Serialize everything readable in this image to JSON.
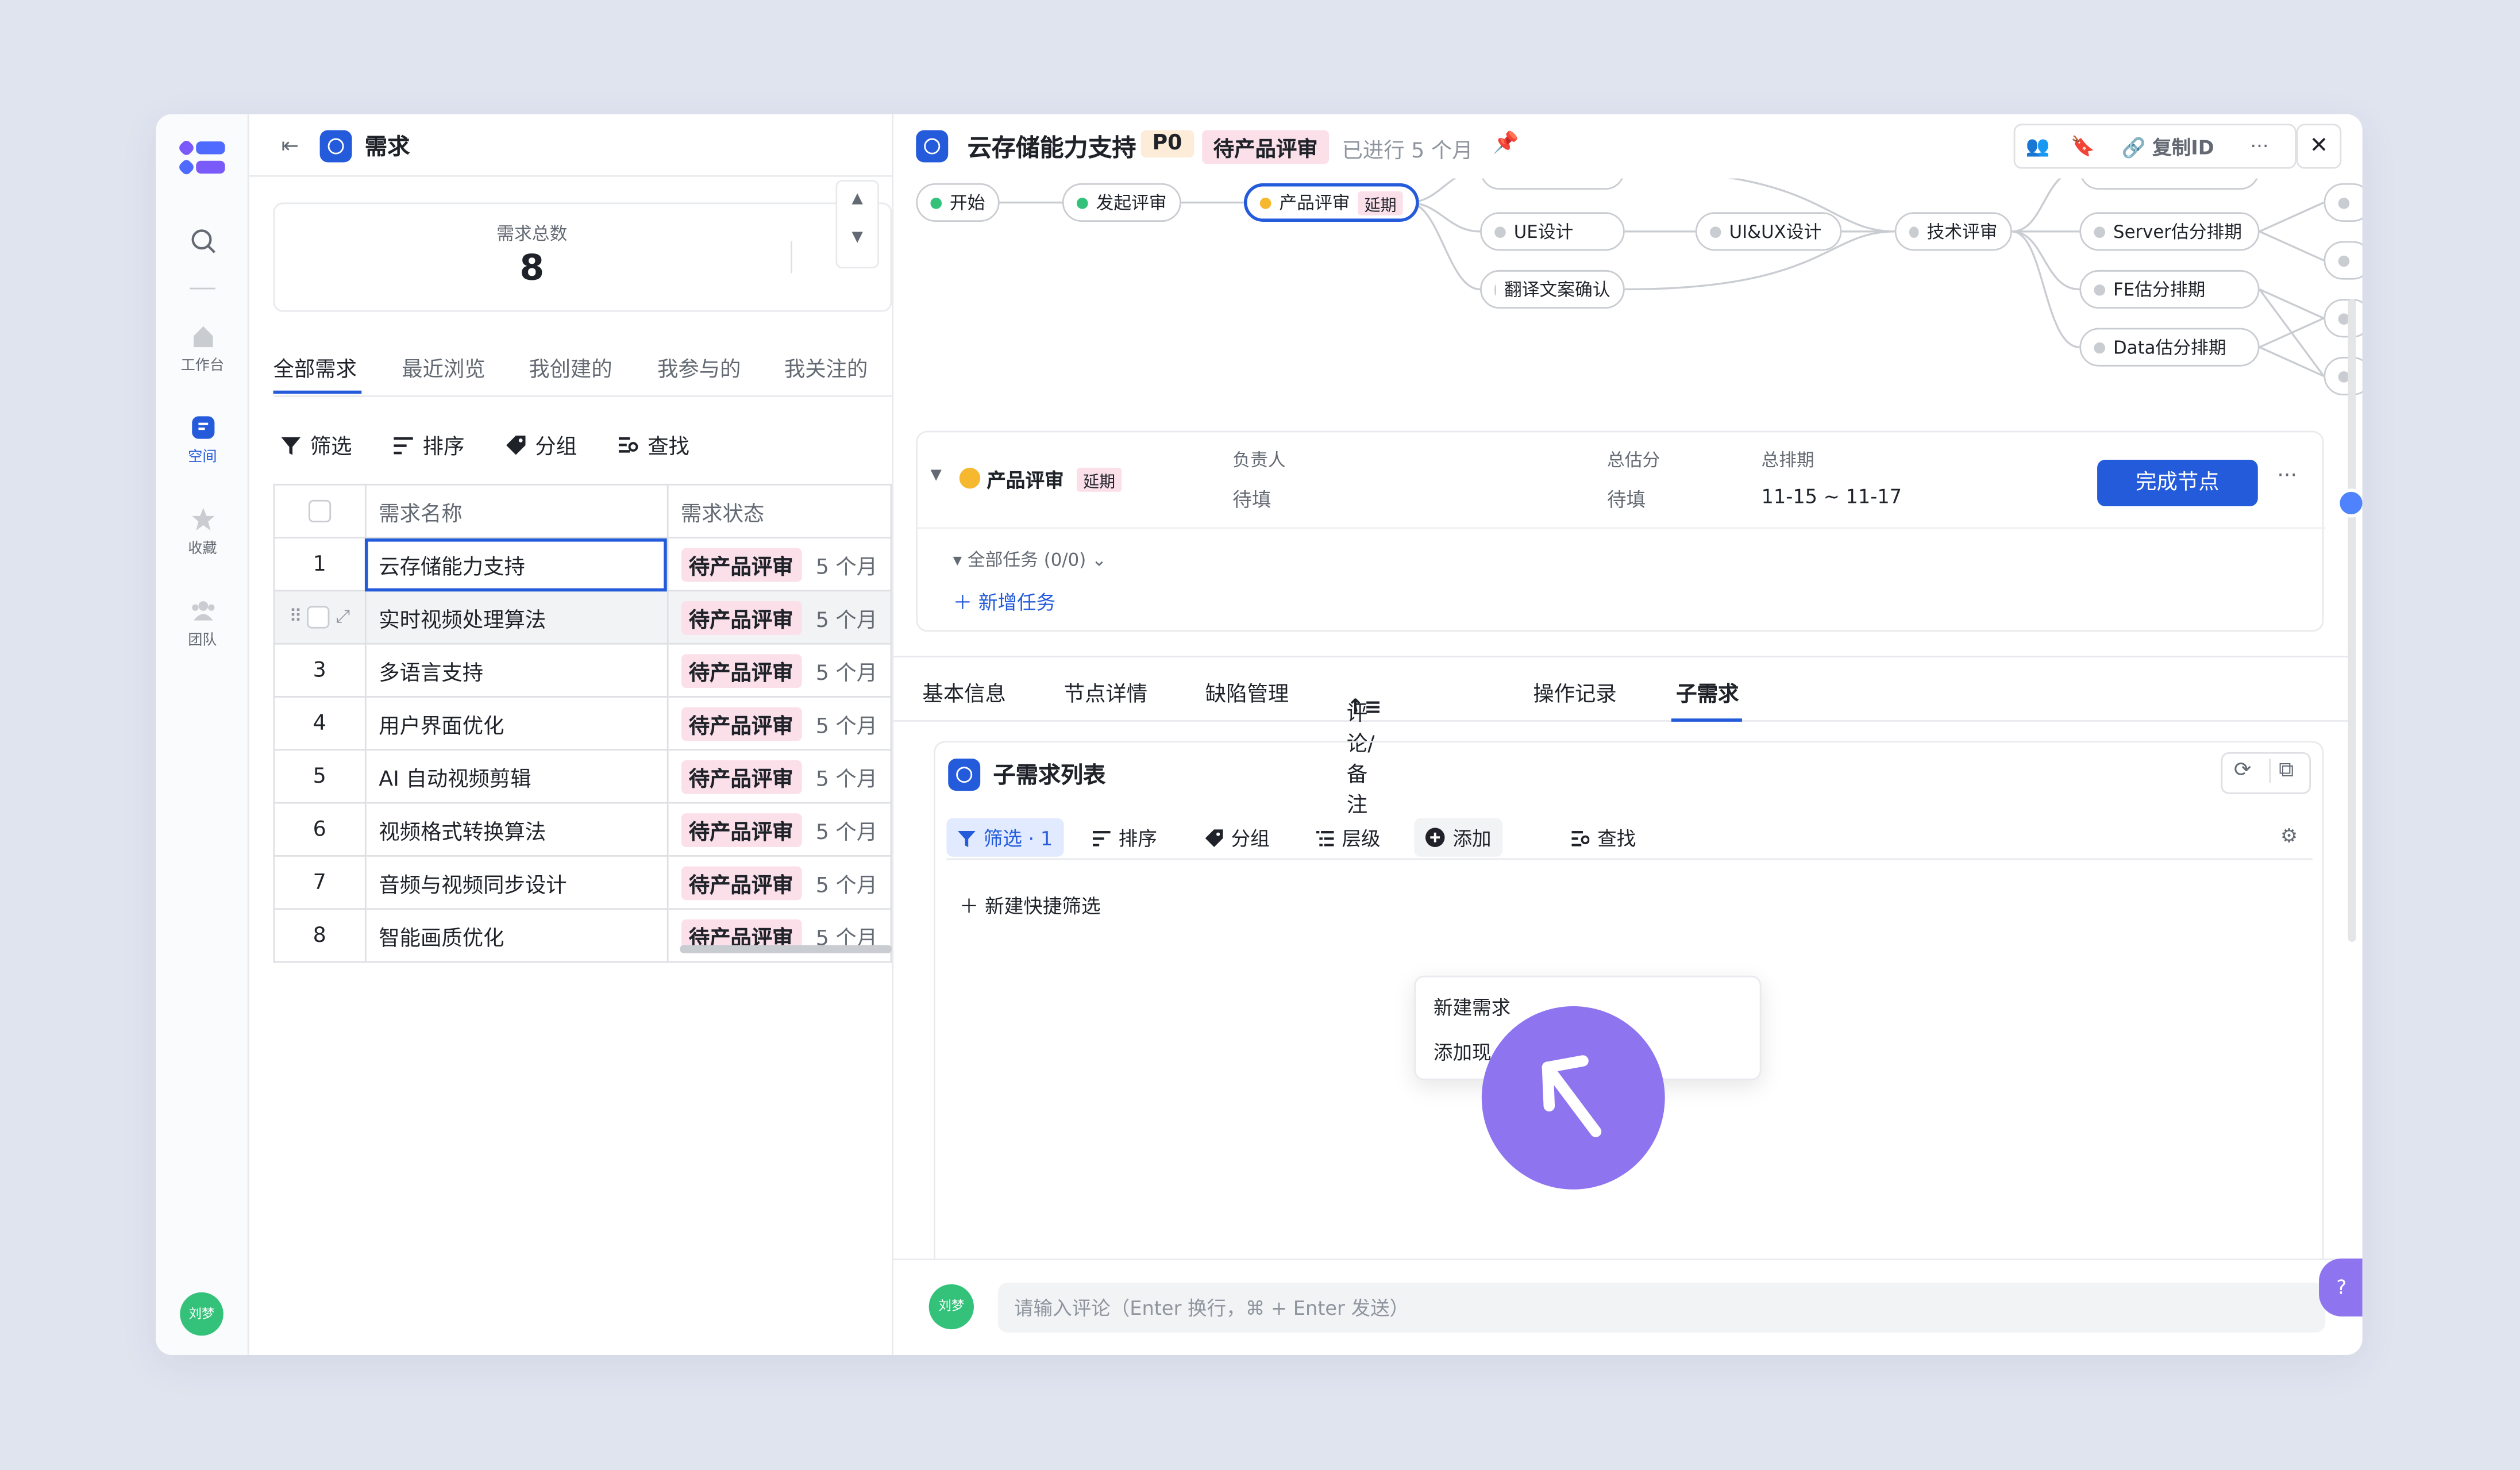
{
  "rail": {
    "items": [
      {
        "label": ""
      },
      {
        "label": "工作台"
      },
      {
        "label": "空间"
      },
      {
        "label": "收藏"
      },
      {
        "label": "团队"
      }
    ],
    "avatar": "刘梦"
  },
  "left": {
    "title": "需求",
    "stat_label": "需求总数",
    "stat_value": "8",
    "tabs": [
      "全部需求",
      "最近浏览",
      "我创建的",
      "我参与的",
      "我关注的"
    ],
    "toolbar": [
      "筛选",
      "排序",
      "分组",
      "查找"
    ],
    "columns": [
      "需求名称",
      "需求状态"
    ],
    "rows": [
      {
        "no": "1",
        "name": "云存储能力支持",
        "status": "待产品评审",
        "dur": "5 个月"
      },
      {
        "no": "",
        "name": "实时视频处理算法",
        "status": "待产品评审",
        "dur": "5 个月"
      },
      {
        "no": "3",
        "name": "多语言支持",
        "status": "待产品评审",
        "dur": "5 个月"
      },
      {
        "no": "4",
        "name": "用户界面优化",
        "status": "待产品评审",
        "dur": "5 个月"
      },
      {
        "no": "5",
        "name": "AI 自动视频剪辑",
        "status": "待产品评审",
        "dur": "5 个月"
      },
      {
        "no": "6",
        "name": "视频格式转换算法",
        "status": "待产品评审",
        "dur": "5 个月"
      },
      {
        "no": "7",
        "name": "音频与视频同步设计",
        "status": "待产品评审",
        "dur": "5 个月"
      },
      {
        "no": "8",
        "name": "智能画质优化",
        "status": "待产品评审",
        "dur": "5 个月"
      }
    ]
  },
  "detail": {
    "title": "云存储能力支持",
    "priority": "P0",
    "status": "待产品评审",
    "elapsed": "已进行 5 个月",
    "copy_id": "复制ID",
    "flow": {
      "start": "开始",
      "launch": "发起评审",
      "current": "产品评审",
      "current_badge": "延期",
      "ue": "UE设计",
      "translate": "翻译文案确认",
      "uiux": "UI&UX设计",
      "tech": "技术评审",
      "server": "Server估分排期",
      "fe": "FE估分排期",
      "data": "Data估分排期"
    },
    "node_card": {
      "name": "产品评审",
      "badge": "延期",
      "owner_label": "负责人",
      "owner_value": "待填",
      "estimate_label": "总估分",
      "estimate_value": "待填",
      "schedule_label": "总排期",
      "schedule_value": "11-15 ~ 11-17",
      "complete_button": "完成节点",
      "all_tasks": "全部任务 (0/0)",
      "add_task": "新增任务"
    },
    "tabs": [
      "基本信息",
      "节点详情",
      "缺陷管理",
      "评论/备注",
      "操作记录",
      "子需求"
    ],
    "subreq": {
      "title": "子需求列表",
      "toolbar": {
        "filter": "筛选 · 1",
        "sort": "排序",
        "group": "分组",
        "level": "层级",
        "add": "添加",
        "find": "查找"
      },
      "quick_filter": "新建快捷筛选",
      "dropdown": [
        "新建需求",
        "添加现"
      ]
    },
    "comment_placeholder": "请输入评论（Enter 换行，⌘ + Enter 发送）",
    "comment_avatar": "刘梦"
  },
  "colors": {
    "accent": "#245bdb",
    "cursor": "#8f74f0",
    "status_pink": "#fbe0ea"
  }
}
